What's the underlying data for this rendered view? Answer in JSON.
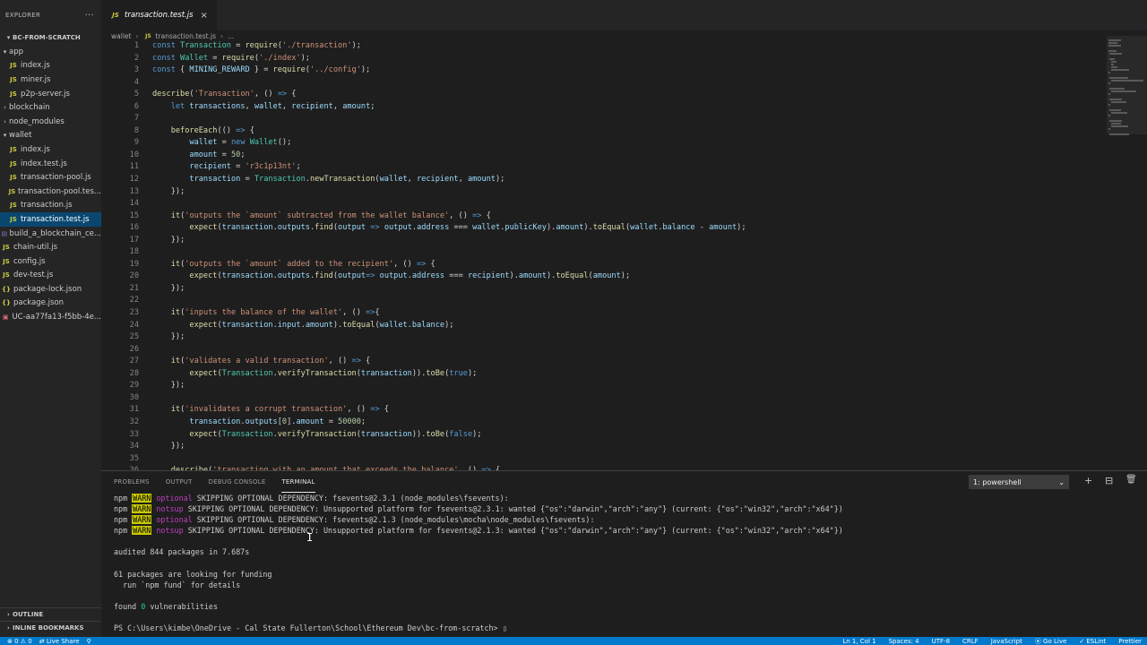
{
  "sidebar": {
    "explorer_label": "EXPLORER",
    "more_label": "···",
    "project_label": "BC-FROM-SCRATCH",
    "items": [
      {
        "label": "app",
        "type": "folder-open",
        "indent": 1
      },
      {
        "label": "index.js",
        "type": "js",
        "indent": 2
      },
      {
        "label": "miner.js",
        "type": "js",
        "indent": 2
      },
      {
        "label": "p2p-server.js",
        "type": "js",
        "indent": 2
      },
      {
        "label": "blockchain",
        "type": "folder",
        "indent": 1
      },
      {
        "label": "node_modules",
        "type": "folder",
        "indent": 1
      },
      {
        "label": "wallet",
        "type": "folder-open",
        "indent": 1
      },
      {
        "label": "index.js",
        "type": "js",
        "indent": 2
      },
      {
        "label": "index.test.js",
        "type": "js",
        "indent": 2
      },
      {
        "label": "transaction-pool.js",
        "type": "js",
        "indent": 2
      },
      {
        "label": "transaction-pool.tes...",
        "type": "js",
        "indent": 2
      },
      {
        "label": "transaction.js",
        "type": "js",
        "indent": 2
      },
      {
        "label": "transaction.test.js",
        "type": "js",
        "indent": 2,
        "active": true
      },
      {
        "label": "build_a_blockchain_ce...",
        "type": "file",
        "indent": 1
      },
      {
        "label": "chain-util.js",
        "type": "js",
        "indent": 1
      },
      {
        "label": "config.js",
        "type": "js",
        "indent": 1
      },
      {
        "label": "dev-test.js",
        "type": "js",
        "indent": 1
      },
      {
        "label": "package-lock.json",
        "type": "json",
        "indent": 1
      },
      {
        "label": "package.json",
        "type": "json",
        "indent": 1
      },
      {
        "label": "UC-aa77fa13-f5bb-4e...",
        "type": "cert",
        "indent": 1
      }
    ],
    "outline_label": "OUTLINE",
    "bookmarks_label": "INLINE BOOKMARKS"
  },
  "editor": {
    "tab_label": "transaction.test.js",
    "tab_icon": "JS",
    "breadcrumb": [
      "wallet",
      "transaction.test.js",
      "..."
    ],
    "code_lines": [
      [
        [
          "k",
          "const "
        ],
        [
          "c",
          "Transaction"
        ],
        [
          "p",
          " = "
        ],
        [
          "f",
          "require"
        ],
        [
          "p",
          "("
        ],
        [
          "s",
          "'./transaction'"
        ],
        [
          "p",
          ");"
        ]
      ],
      [
        [
          "k",
          "const "
        ],
        [
          "c",
          "Wallet"
        ],
        [
          "p",
          " = "
        ],
        [
          "f",
          "require"
        ],
        [
          "p",
          "("
        ],
        [
          "s",
          "'./index'"
        ],
        [
          "p",
          ");"
        ]
      ],
      [
        [
          "k",
          "const "
        ],
        [
          "p",
          "{ "
        ],
        [
          "v",
          "MINING_REWARD"
        ],
        [
          "p",
          " } = "
        ],
        [
          "f",
          "require"
        ],
        [
          "p",
          "("
        ],
        [
          "s",
          "'../config'"
        ],
        [
          "p",
          ");"
        ]
      ],
      [],
      [
        [
          "f",
          "describe"
        ],
        [
          "p",
          "("
        ],
        [
          "s",
          "'Transaction'"
        ],
        [
          "p",
          ", () "
        ],
        [
          "k",
          "=>"
        ],
        [
          "p",
          " {"
        ]
      ],
      [
        [
          "p",
          "    "
        ],
        [
          "k",
          "let "
        ],
        [
          "v",
          "transactions"
        ],
        [
          "p",
          ", "
        ],
        [
          "v",
          "wallet"
        ],
        [
          "p",
          ", "
        ],
        [
          "v",
          "recipient"
        ],
        [
          "p",
          ", "
        ],
        [
          "v",
          "amount"
        ],
        [
          "p",
          ";"
        ]
      ],
      [],
      [
        [
          "p",
          "    "
        ],
        [
          "f",
          "beforeEach"
        ],
        [
          "p",
          "(() "
        ],
        [
          "k",
          "=>"
        ],
        [
          "p",
          " {"
        ]
      ],
      [
        [
          "p",
          "        "
        ],
        [
          "v",
          "wallet"
        ],
        [
          "p",
          " = "
        ],
        [
          "k",
          "new "
        ],
        [
          "c",
          "Wallet"
        ],
        [
          "p",
          "();"
        ]
      ],
      [
        [
          "p",
          "        "
        ],
        [
          "v",
          "amount"
        ],
        [
          "p",
          " = "
        ],
        [
          "n",
          "50"
        ],
        [
          "p",
          ";"
        ]
      ],
      [
        [
          "p",
          "        "
        ],
        [
          "v",
          "recipient"
        ],
        [
          "p",
          " = "
        ],
        [
          "s",
          "'r3c1p13nt'"
        ],
        [
          "p",
          ";"
        ]
      ],
      [
        [
          "p",
          "        "
        ],
        [
          "v",
          "transaction"
        ],
        [
          "p",
          " = "
        ],
        [
          "c",
          "Transaction"
        ],
        [
          "p",
          "."
        ],
        [
          "f",
          "newTransaction"
        ],
        [
          "p",
          "("
        ],
        [
          "v",
          "wallet"
        ],
        [
          "p",
          ", "
        ],
        [
          "v",
          "recipient"
        ],
        [
          "p",
          ", "
        ],
        [
          "v",
          "amount"
        ],
        [
          "p",
          ");"
        ]
      ],
      [
        [
          "p",
          "    });"
        ]
      ],
      [],
      [
        [
          "p",
          "    "
        ],
        [
          "f",
          "it"
        ],
        [
          "p",
          "("
        ],
        [
          "s",
          "'outputs the `amount` subtracted from the wallet balance'"
        ],
        [
          "p",
          ", () "
        ],
        [
          "k",
          "=>"
        ],
        [
          "p",
          " {"
        ]
      ],
      [
        [
          "p",
          "        "
        ],
        [
          "f",
          "expect"
        ],
        [
          "p",
          "("
        ],
        [
          "v",
          "transaction"
        ],
        [
          "p",
          "."
        ],
        [
          "v",
          "outputs"
        ],
        [
          "p",
          "."
        ],
        [
          "f",
          "find"
        ],
        [
          "p",
          "("
        ],
        [
          "v",
          "output"
        ],
        [
          "p",
          " "
        ],
        [
          "k",
          "=>"
        ],
        [
          "p",
          " "
        ],
        [
          "v",
          "output"
        ],
        [
          "p",
          "."
        ],
        [
          "v",
          "address"
        ],
        [
          "p",
          " === "
        ],
        [
          "v",
          "wallet"
        ],
        [
          "p",
          "."
        ],
        [
          "v",
          "publicKey"
        ],
        [
          "p",
          ")."
        ],
        [
          "v",
          "amount"
        ],
        [
          "p",
          ")."
        ],
        [
          "f",
          "toEqual"
        ],
        [
          "p",
          "("
        ],
        [
          "v",
          "wallet"
        ],
        [
          "p",
          "."
        ],
        [
          "v",
          "balance"
        ],
        [
          "p",
          " - "
        ],
        [
          "v",
          "amount"
        ],
        [
          "p",
          ");"
        ]
      ],
      [
        [
          "p",
          "    });"
        ]
      ],
      [],
      [
        [
          "p",
          "    "
        ],
        [
          "f",
          "it"
        ],
        [
          "p",
          "("
        ],
        [
          "s",
          "'outputs the `amount` added to the recipient'"
        ],
        [
          "p",
          ", () "
        ],
        [
          "k",
          "=>"
        ],
        [
          "p",
          " {"
        ]
      ],
      [
        [
          "p",
          "        "
        ],
        [
          "f",
          "expect"
        ],
        [
          "p",
          "("
        ],
        [
          "v",
          "transaction"
        ],
        [
          "p",
          "."
        ],
        [
          "v",
          "outputs"
        ],
        [
          "p",
          "."
        ],
        [
          "f",
          "find"
        ],
        [
          "p",
          "("
        ],
        [
          "v",
          "output"
        ],
        [
          "k",
          "=>"
        ],
        [
          "p",
          " "
        ],
        [
          "v",
          "output"
        ],
        [
          "p",
          "."
        ],
        [
          "v",
          "address"
        ],
        [
          "p",
          " === "
        ],
        [
          "v",
          "recipient"
        ],
        [
          "p",
          ")."
        ],
        [
          "v",
          "amount"
        ],
        [
          "p",
          ")."
        ],
        [
          "f",
          "toEqual"
        ],
        [
          "p",
          "("
        ],
        [
          "v",
          "amount"
        ],
        [
          "p",
          ");"
        ]
      ],
      [
        [
          "p",
          "    });"
        ]
      ],
      [],
      [
        [
          "p",
          "    "
        ],
        [
          "f",
          "it"
        ],
        [
          "p",
          "("
        ],
        [
          "s",
          "'inputs the balance of the wallet'"
        ],
        [
          "p",
          ", () "
        ],
        [
          "k",
          "=>"
        ],
        [
          "p",
          "{"
        ]
      ],
      [
        [
          "p",
          "        "
        ],
        [
          "f",
          "expect"
        ],
        [
          "p",
          "("
        ],
        [
          "v",
          "transaction"
        ],
        [
          "p",
          "."
        ],
        [
          "v",
          "input"
        ],
        [
          "p",
          "."
        ],
        [
          "v",
          "amount"
        ],
        [
          "p",
          ")."
        ],
        [
          "f",
          "toEqual"
        ],
        [
          "p",
          "("
        ],
        [
          "v",
          "wallet"
        ],
        [
          "p",
          "."
        ],
        [
          "v",
          "balance"
        ],
        [
          "p",
          ");"
        ]
      ],
      [
        [
          "p",
          "    });"
        ]
      ],
      [],
      [
        [
          "p",
          "    "
        ],
        [
          "f",
          "it"
        ],
        [
          "p",
          "("
        ],
        [
          "s",
          "'validates a valid transaction'"
        ],
        [
          "p",
          ", () "
        ],
        [
          "k",
          "=>"
        ],
        [
          "p",
          " {"
        ]
      ],
      [
        [
          "p",
          "        "
        ],
        [
          "f",
          "expect"
        ],
        [
          "p",
          "("
        ],
        [
          "c",
          "Transaction"
        ],
        [
          "p",
          "."
        ],
        [
          "f",
          "verifyTransaction"
        ],
        [
          "p",
          "("
        ],
        [
          "v",
          "transaction"
        ],
        [
          "p",
          "))."
        ],
        [
          "f",
          "toBe"
        ],
        [
          "p",
          "("
        ],
        [
          "k",
          "true"
        ],
        [
          "p",
          ");"
        ]
      ],
      [
        [
          "p",
          "    });"
        ]
      ],
      [],
      [
        [
          "p",
          "    "
        ],
        [
          "f",
          "it"
        ],
        [
          "p",
          "("
        ],
        [
          "s",
          "'invalidates a corrupt transaction'"
        ],
        [
          "p",
          ", () "
        ],
        [
          "k",
          "=>"
        ],
        [
          "p",
          " {"
        ]
      ],
      [
        [
          "p",
          "        "
        ],
        [
          "v",
          "transaction"
        ],
        [
          "p",
          "."
        ],
        [
          "v",
          "outputs"
        ],
        [
          "p",
          "["
        ],
        [
          "n",
          "0"
        ],
        [
          "p",
          "]."
        ],
        [
          "v",
          "amount"
        ],
        [
          "p",
          " = "
        ],
        [
          "n",
          "50000"
        ],
        [
          "p",
          ";"
        ]
      ],
      [
        [
          "p",
          "        "
        ],
        [
          "f",
          "expect"
        ],
        [
          "p",
          "("
        ],
        [
          "c",
          "Transaction"
        ],
        [
          "p",
          "."
        ],
        [
          "f",
          "verifyTransaction"
        ],
        [
          "p",
          "("
        ],
        [
          "v",
          "transaction"
        ],
        [
          "p",
          "))."
        ],
        [
          "f",
          "toBe"
        ],
        [
          "p",
          "("
        ],
        [
          "k",
          "false"
        ],
        [
          "p",
          ");"
        ]
      ],
      [
        [
          "p",
          "    });"
        ]
      ],
      [],
      [
        [
          "p",
          "    "
        ],
        [
          "f",
          "describe"
        ],
        [
          "p",
          "("
        ],
        [
          "s",
          "'transacting with an amount that exceeds the balance'"
        ],
        [
          "p",
          ", () "
        ],
        [
          "k",
          "=>"
        ],
        [
          "p",
          " {"
        ]
      ]
    ]
  },
  "panel": {
    "tabs": [
      "PROBLEMS",
      "OUTPUT",
      "DEBUG CONSOLE",
      "TERMINAL"
    ],
    "active_tab": 3,
    "terminal_select": "1: powershell",
    "plus_icon": "+",
    "split_icon": "⊟",
    "trash_icon": "🗑",
    "terminal_lines": [
      [
        [
          "t",
          "npm "
        ],
        [
          "warn",
          "WARN"
        ],
        [
          "t",
          " "
        ],
        [
          "mag",
          "optional"
        ],
        [
          "t",
          " SKIPPING OPTIONAL DEPENDENCY: fsevents@2.3.1 (node_modules\\fsevents):"
        ]
      ],
      [
        [
          "t",
          "npm "
        ],
        [
          "warn",
          "WARN"
        ],
        [
          "t",
          " "
        ],
        [
          "mag",
          "notsup"
        ],
        [
          "t",
          " SKIPPING OPTIONAL DEPENDENCY: Unsupported platform for fsevents@2.3.1: wanted {\"os\":\"darwin\",\"arch\":\"any\"} (current: {\"os\":\"win32\",\"arch\":\"x64\"})"
        ]
      ],
      [
        [
          "t",
          "npm "
        ],
        [
          "warn",
          "WARN"
        ],
        [
          "t",
          " "
        ],
        [
          "mag",
          "optional"
        ],
        [
          "t",
          " SKIPPING OPTIONAL DEPENDENCY: fsevents@2.1.3 (node_modules\\mocha\\node_modules\\fsevents):"
        ]
      ],
      [
        [
          "t",
          "npm "
        ],
        [
          "warn",
          "WARN"
        ],
        [
          "t",
          " "
        ],
        [
          "mag",
          "notsup"
        ],
        [
          "t",
          " SKIPPING OPTIONAL DEPENDENCY: Unsupported platform for fsevents@2.1.3: wanted {\"os\":\"darwin\",\"arch\":\"any\"} (current: {\"os\":\"win32\",\"arch\":\"x64\"})"
        ]
      ],
      [],
      [
        [
          "t",
          "audited 844 packages in 7.687s"
        ]
      ],
      [],
      [
        [
          "t",
          "61 packages are looking for funding"
        ]
      ],
      [
        [
          "t",
          "  run `npm fund` for details"
        ]
      ],
      [],
      [
        [
          "t",
          "found "
        ],
        [
          "green",
          "0"
        ],
        [
          "t",
          " vulnerabilities"
        ]
      ],
      [],
      [
        [
          "t",
          "PS C:\\Users\\kimbe\\OneDrive - Cal State Fullerton\\School\\Ethereum Dev\\bc-from-scratch> "
        ],
        [
          "cur",
          "▯"
        ]
      ]
    ]
  },
  "statusbar": {
    "left": [
      "⊗ 0  ⚠ 0",
      "⇄ Live Share",
      "⚲"
    ],
    "right": [
      "Ln 1, Col 1",
      "Spaces: 4",
      "UTF-8",
      "CRLF",
      "JavaScript",
      "⦿ Go Live",
      "✓ ESLint",
      "Prettier"
    ]
  },
  "colors": {
    "accent": "#007acc",
    "warn_bg": "#c9c900",
    "keyword": "#569cd6",
    "string": "#ce9178",
    "function": "#dcdcaa"
  }
}
